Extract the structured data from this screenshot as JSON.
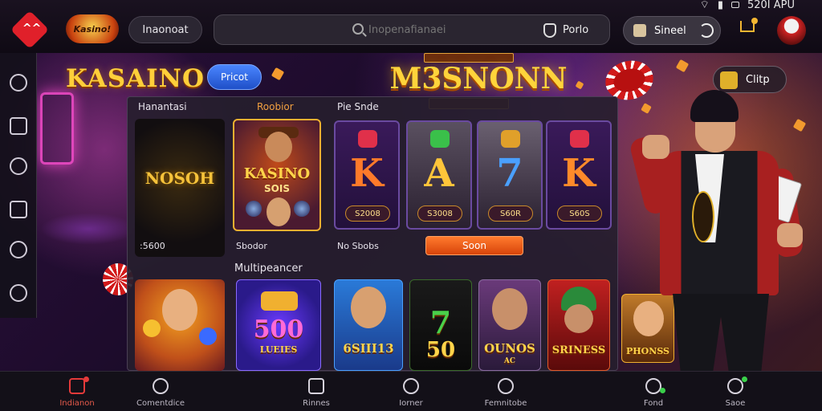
{
  "status_bar": {
    "time": "520I APU"
  },
  "header": {
    "brand": "Kasino!",
    "language_pill": "Inaonoat",
    "search_placeholder": "Inopenafianaei",
    "search_right_label": "Porlo",
    "account_label": "Sineel"
  },
  "hero": {
    "title": "KASAINO",
    "cta": "Pricot",
    "game_title": "M3SNONN",
    "clip_label": "Clitp"
  },
  "sections": {
    "top_label": "Hanantasi",
    "mid_label": "Roobior",
    "slots_label": "Pie Snde",
    "multi_label": "Multipeancer"
  },
  "cards": {
    "dark_title": "NOSOH",
    "dark_caption": ":5600",
    "kasino_title": "KASINO",
    "kasino_sub": "SOIS",
    "kasino_caption": "Sbodor",
    "slots_caption": "No Sbobs"
  },
  "reels": [
    {
      "symbol": "K",
      "value": "S2008",
      "color": "#ff7a2a",
      "gem": "#e0304a"
    },
    {
      "symbol": "A",
      "value": "S3008",
      "color": "#ffc53a",
      "gem": "#3ac04a"
    },
    {
      "symbol": "7",
      "value": "S60R",
      "color": "#4aa0ff",
      "gem": "#e0a02a"
    },
    {
      "symbol": "K",
      "value": "S60S",
      "color": "#ff8a2a",
      "gem": "#e0304a"
    }
  ],
  "spin_label": "Soon",
  "games_bottom": [
    {
      "title": ""
    },
    {
      "title": "500",
      "sub": "LUEIES"
    },
    {
      "title": "6SIII13"
    },
    {
      "title": "50"
    },
    {
      "title": "OUNOS",
      "sub": "AC"
    },
    {
      "title": "SRINESS"
    },
    {
      "title": "PHONSS"
    }
  ],
  "nav": [
    {
      "label": "Indianon"
    },
    {
      "label": "Comentdice"
    },
    {
      "label": "Rinnes"
    },
    {
      "label": "Iorner"
    },
    {
      "label": "Femnitobe"
    },
    {
      "label": "Fond"
    },
    {
      "label": "Saoe"
    }
  ],
  "colors": {
    "accent": "#ff6a1a",
    "gold": "#ffd43b",
    "active_nav": "#e53a3a"
  }
}
